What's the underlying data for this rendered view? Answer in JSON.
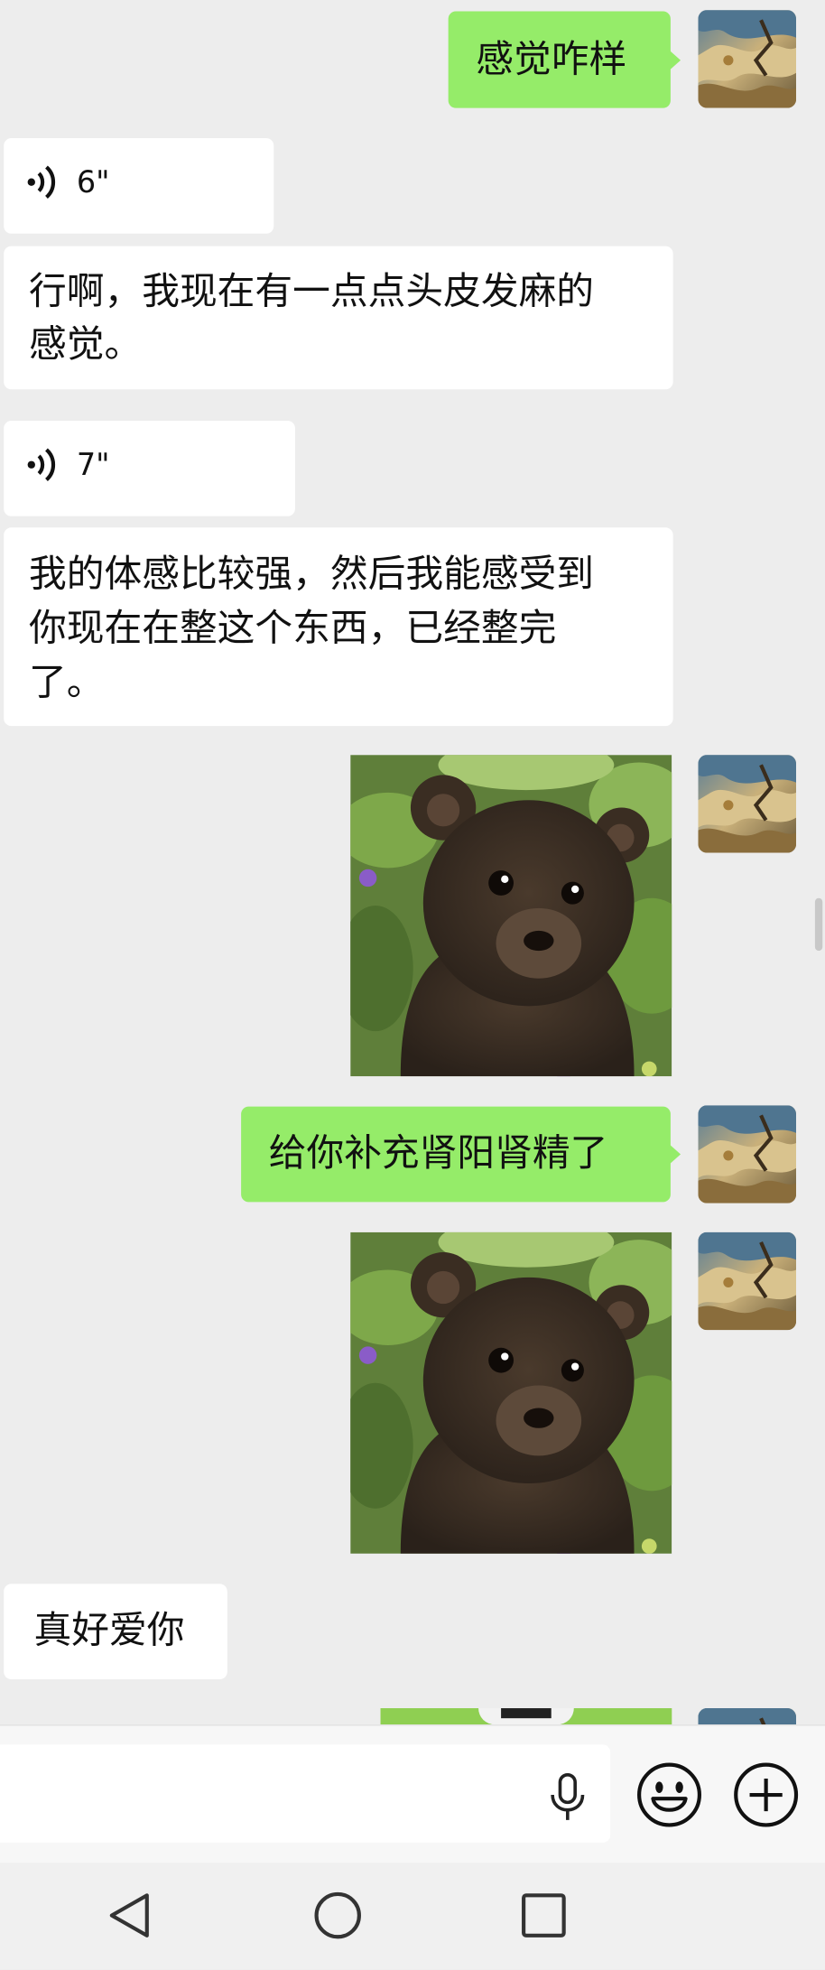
{
  "colors": {
    "background": "#ededed",
    "incoming_bubble": "#ffffff",
    "outgoing_bubble": "#95ec69"
  },
  "messages": [
    {
      "direction": "outgoing",
      "type": "text",
      "text": "感觉咋样"
    },
    {
      "direction": "incoming",
      "type": "voice",
      "duration": "6\""
    },
    {
      "direction": "incoming",
      "type": "text",
      "line1": "行啊，我现在有一点点头皮发麻的",
      "line2": "感觉。"
    },
    {
      "direction": "incoming",
      "type": "voice",
      "duration": "7\""
    },
    {
      "direction": "incoming",
      "type": "text",
      "line1": "我的体感比较强，然后我能感受到",
      "line2": "你现在在整这个东西，已经整完",
      "line3": "了。"
    },
    {
      "direction": "outgoing",
      "type": "image",
      "subject": "brown bear cub among green leaves"
    },
    {
      "direction": "outgoing",
      "type": "text",
      "text": "给你补充肾阳肾精了"
    },
    {
      "direction": "outgoing",
      "type": "image",
      "subject": "brown bear cub among green leaves"
    },
    {
      "direction": "incoming",
      "type": "text",
      "text": "真好爱你"
    },
    {
      "direction": "outgoing",
      "type": "image",
      "subject": "partially visible image (cut off)"
    }
  ],
  "input_bar": {
    "icons": [
      "microphone-icon",
      "emoji-icon",
      "plus-icon"
    ]
  },
  "nav_bar": {
    "icons": [
      "back-triangle-icon",
      "home-circle-icon",
      "recents-square-icon"
    ]
  }
}
